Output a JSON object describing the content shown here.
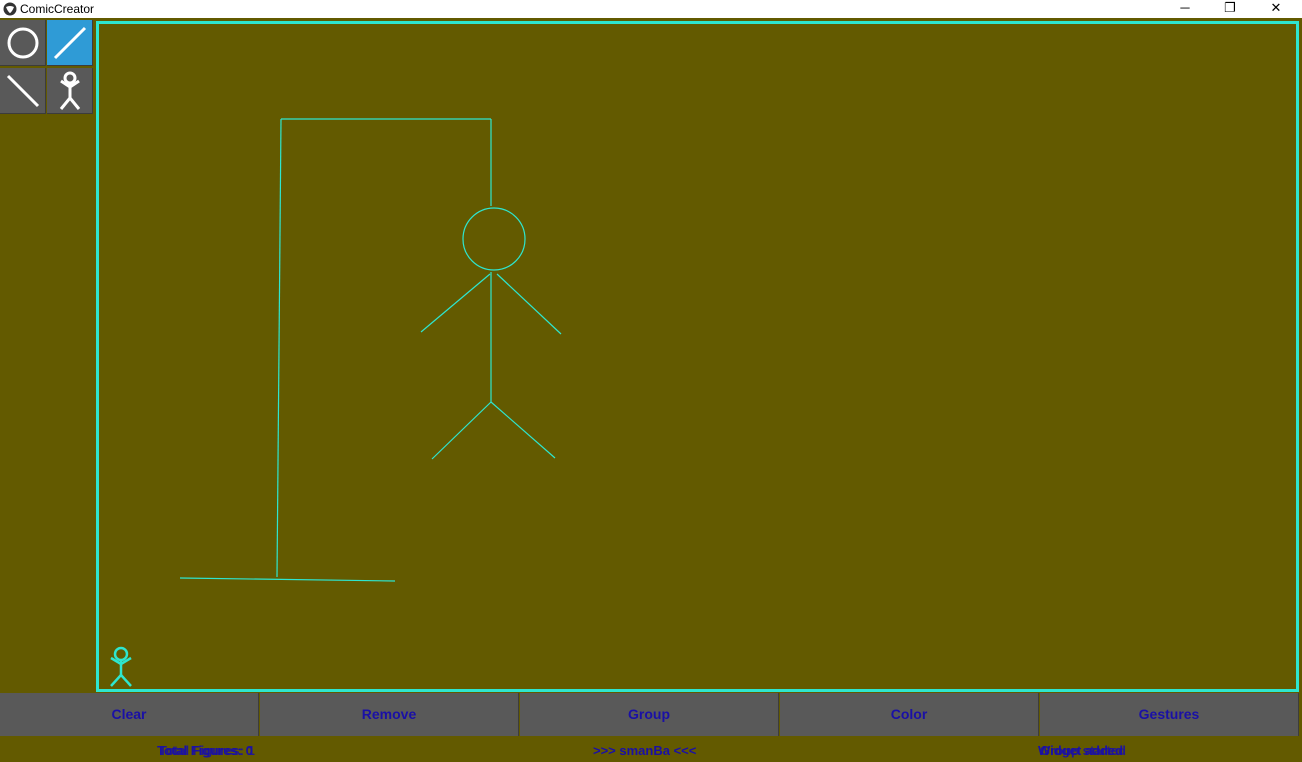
{
  "window": {
    "title": "ComicCreator",
    "minimize_glyph": "─",
    "restore_glyph": "❐",
    "close_glyph": "✕"
  },
  "tools": [
    {
      "name": "circle-tool",
      "icon": "circle-icon",
      "active": false
    },
    {
      "name": "line-tool",
      "icon": "line-icon",
      "active": true
    },
    {
      "name": "backslash-line-tool",
      "icon": "line-icon",
      "active": false
    },
    {
      "name": "stickman-tool",
      "icon": "stickman-icon",
      "active": false
    }
  ],
  "canvas": {
    "border_color": "#2ee6cf",
    "stroke_color": "#2ee6cf",
    "background_color": "#635a00"
  },
  "toolbar": {
    "clear_label": "Clear",
    "remove_label": "Remove",
    "group_label": "Group",
    "color_label": "Color",
    "gestures_label": "Gestures"
  },
  "status": {
    "figures_text_a": "Total Figures: 0",
    "figures_text_b": "Total Figures: 1",
    "center_text": ">>> smanBa <<<",
    "right_text_a": "Widget added",
    "right_text_b": "Group started"
  },
  "colors": {
    "toolbar_text": "#1a10a6",
    "button_bg": "#595959",
    "active_tool": "#2f9bd6"
  }
}
